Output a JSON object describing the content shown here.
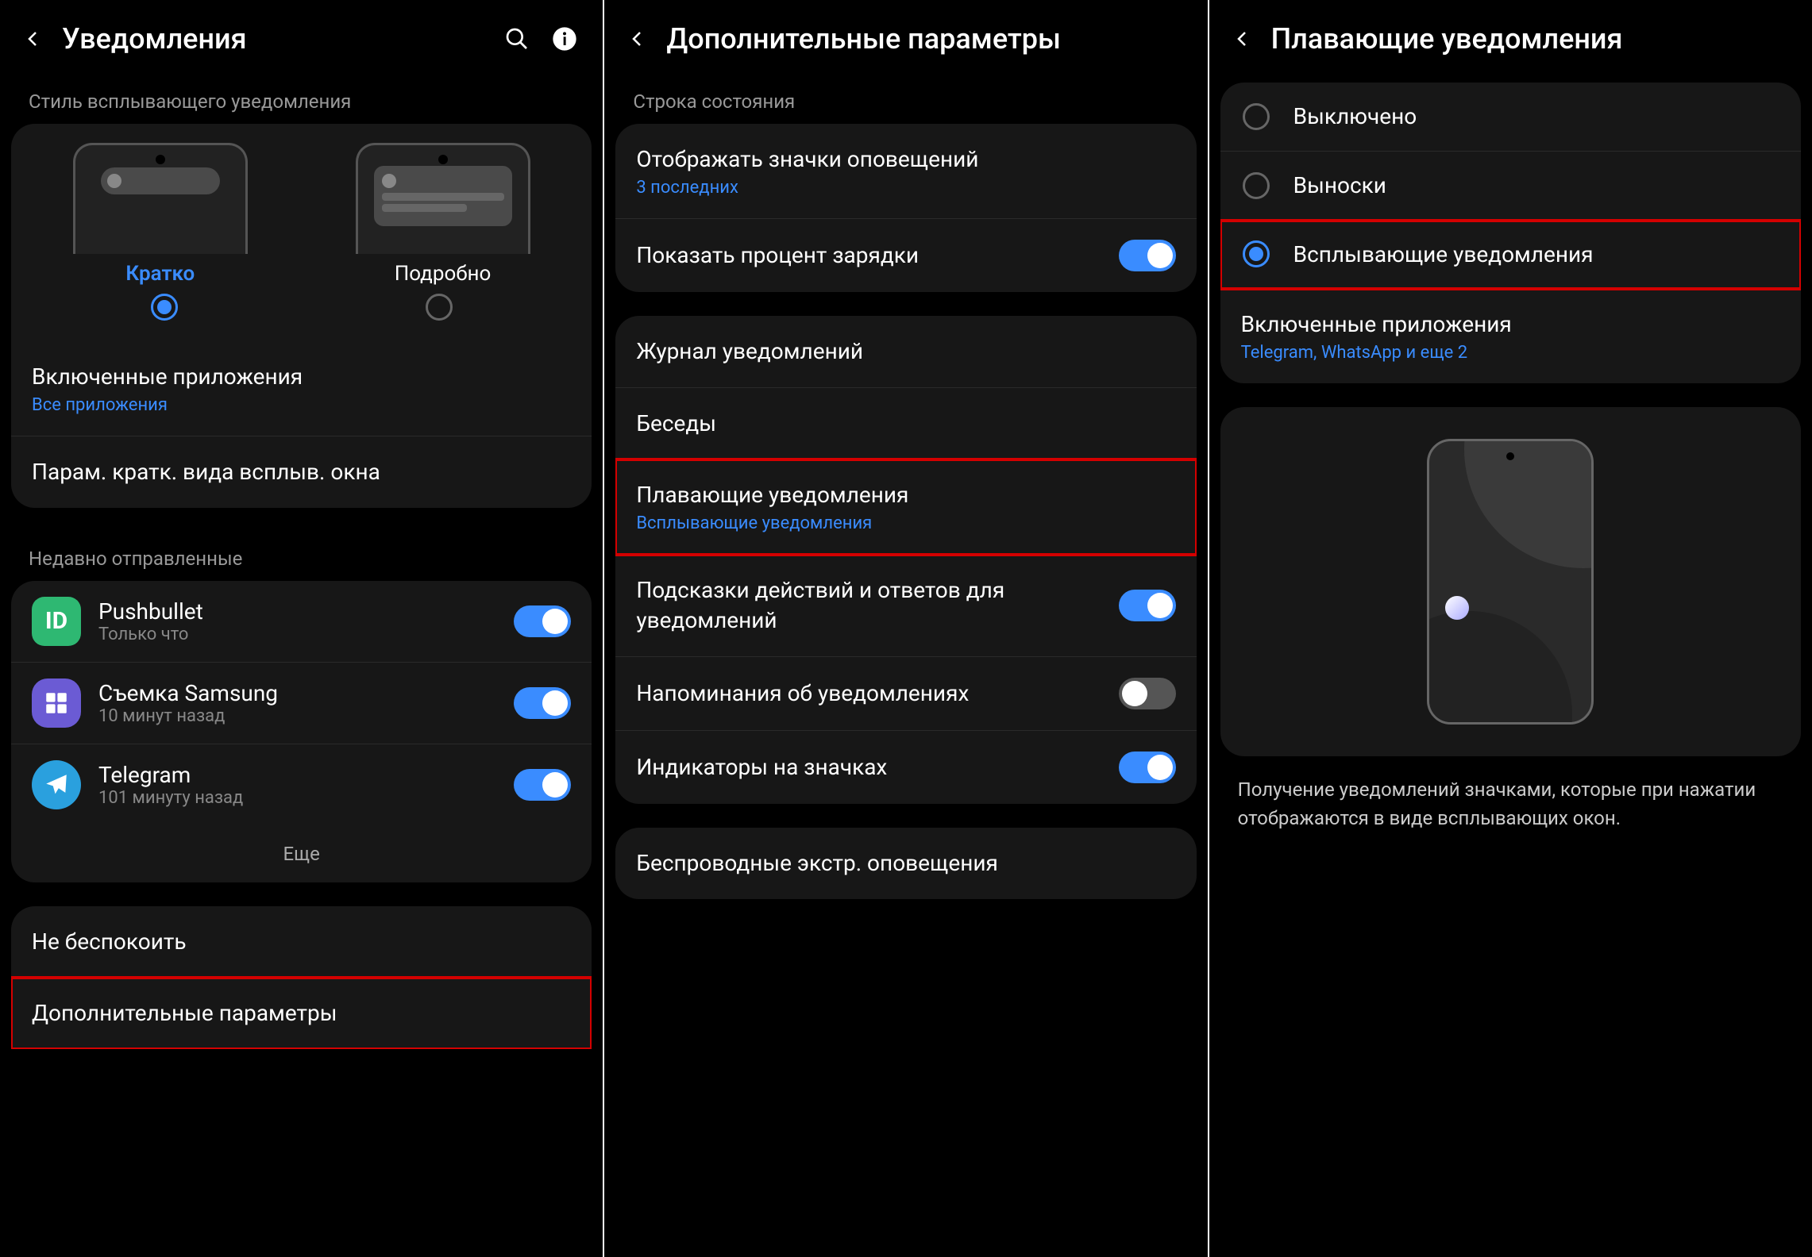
{
  "screen1": {
    "title": "Уведомления",
    "section_style": "Стиль всплывающего уведомления",
    "style_brief": "Кратко",
    "style_detail": "Подробно",
    "included_apps": "Включенные приложения",
    "included_apps_sub": "Все приложения",
    "brief_params": "Парам. кратк. вида всплыв. окна",
    "section_recent": "Недавно отправленные",
    "apps": [
      {
        "name": "Pushbullet",
        "time": "Только что",
        "color": "#2eb872",
        "letter": "ID"
      },
      {
        "name": "Съемка Samsung",
        "time": "10 минут назад",
        "color": "#6b5bd4",
        "letter": "✦"
      },
      {
        "name": "Telegram",
        "time": "101 минуту назад",
        "color": "#2aa0de",
        "letter": "▶"
      }
    ],
    "more": "Еще",
    "dnd": "Не беспокоить",
    "advanced": "Дополнительные параметры"
  },
  "screen2": {
    "title": "Дополнительные параметры",
    "section_status": "Строка состояния",
    "show_icons": "Отображать значки оповещений",
    "show_icons_sub": "3 последних",
    "show_battery": "Показать процент зарядки",
    "journal": "Журнал уведомлений",
    "conversations": "Беседы",
    "floating": "Плавающие уведомления",
    "floating_sub": "Всплывающие уведомления",
    "hints": "Подсказки действий и ответов для уведомлений",
    "reminders": "Напоминания об уведомлениях",
    "badges": "Индикаторы на значках",
    "wireless": "Беспроводные экстр. оповещения"
  },
  "screen3": {
    "title": "Плавающие уведомления",
    "opt_off": "Выключено",
    "opt_bubbles": "Выноски",
    "opt_popup": "Всплывающие уведомления",
    "included_apps": "Включенные приложения",
    "included_apps_sub": "Telegram, WhatsApp и еще 2",
    "description": "Получение уведомлений значками, которые при нажатии отображаются в виде всплывающих окон."
  }
}
